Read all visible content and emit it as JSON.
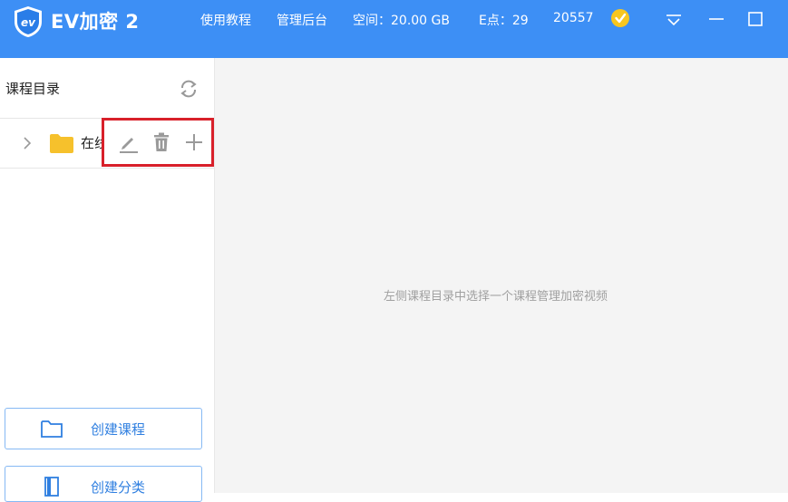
{
  "titlebar": {
    "app_title": "EV加密 2",
    "tutorial": "使用教程",
    "admin": "管理后台",
    "space": "空间：20.00 GB",
    "epoints": "E点：29",
    "user_id": "20557"
  },
  "sidebar": {
    "title": "课程目录",
    "tree_items": [
      {
        "label": "在线"
      }
    ],
    "create_course": "创建课程",
    "create_category": "创建分类"
  },
  "main": {
    "placeholder": "左侧课程目录中选择一个课程管理加密视频"
  },
  "colors": {
    "titlebar": "#3d8ff5",
    "highlight": "#d8202a",
    "folder": "#f6c12c",
    "accent": "#2f7fe0"
  }
}
